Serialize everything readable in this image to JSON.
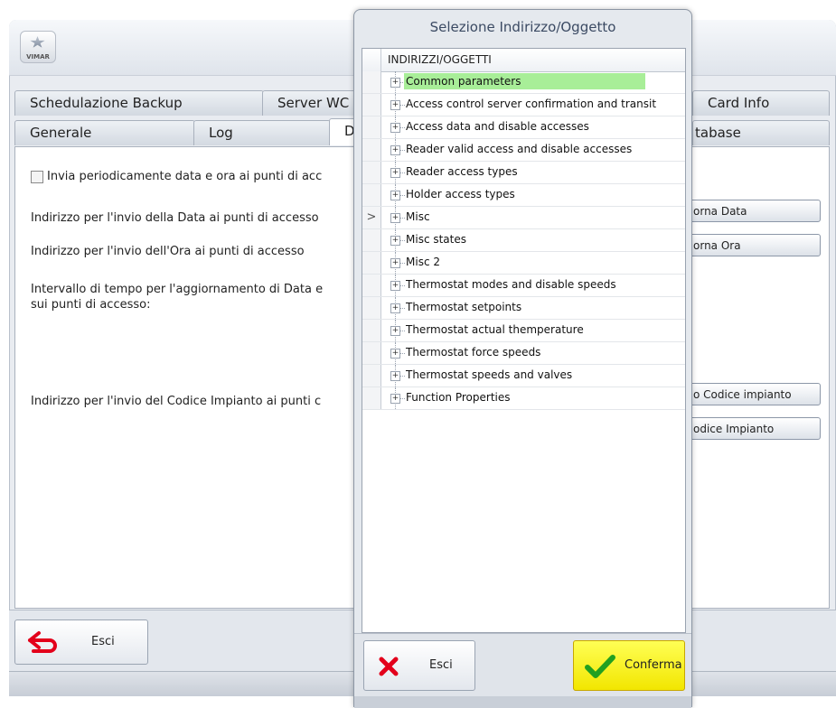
{
  "background_window": {
    "logo_text": "VIMAR",
    "tabs_row1": [
      "Schedulazione Backup",
      "Server WC",
      "Card Info"
    ],
    "tabs_row2": [
      "Generale",
      "Log",
      "D",
      "tabase"
    ],
    "checkbox_label": "Invia periodicamente data e ora ai punti di acc",
    "label_date_address": "Indirizzo per l'invio della Data ai punti di accesso",
    "label_time_address": "Indirizzo per l'invio dell'Ora ai punti di accesso",
    "label_interval_line1": "Intervallo di tempo per l'aggiornamento di Data e",
    "label_interval_line2": "sui punti di accesso:",
    "label_code_address": "Indirizzo per l'invio del Codice Impianto ai punti c",
    "btn_update_date": "orna Data",
    "btn_update_time": "orna Ora",
    "btn_code1": "o Codice impianto",
    "btn_code2": "odice Impianto",
    "exit_label": "Esci"
  },
  "dialog": {
    "title": "Selezione Indirizzo/Oggetto",
    "column_header": "INDIRIZZI/OGGETTI",
    "items": [
      "Common parameters",
      "Access control server confirmation and transit",
      "Access data and disable accesses",
      "Reader valid access and disable accesses",
      "Reader access types",
      "Holder access types",
      "Misc",
      "Misc states",
      "Misc 2",
      "Thermostat modes and disable speeds",
      "Thermostat setpoints",
      "Thermostat actual themperature",
      "Thermostat force speeds",
      "Thermostat speeds and valves",
      "Function Properties"
    ],
    "highlighted_index": 0,
    "current_row_index": 6,
    "expand_glyph": "+",
    "current_row_glyph": ">",
    "esci_label": "Esci",
    "conferma_label": "Conferma"
  },
  "colors": {
    "highlight": "#a8ee98",
    "confirm_button": "#f5eb00",
    "exit_icon": "#e3001b",
    "check_icon": "#22a020"
  }
}
